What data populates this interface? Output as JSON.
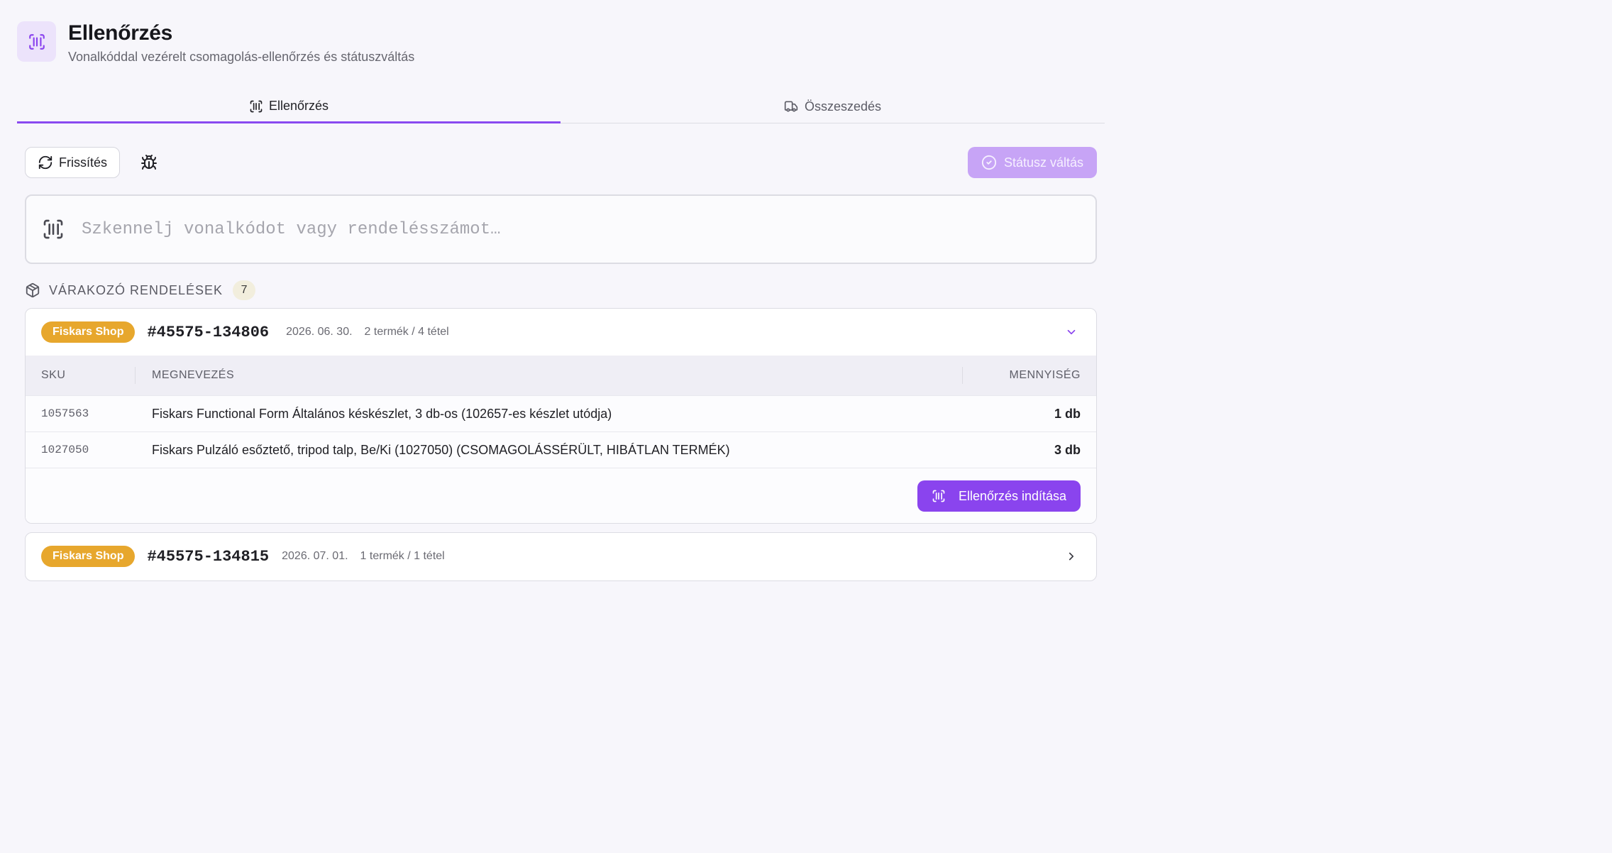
{
  "header": {
    "icon": "barcode-icon",
    "title": "Ellenőrzés",
    "subtitle": "Vonalkóddal vezérelt csomagolás-ellenőrzés és státuszváltás"
  },
  "tabs": [
    {
      "label": "Ellenőrzés",
      "icon": "barcode-icon",
      "active": true
    },
    {
      "label": "Összeszedés",
      "icon": "truck-icon",
      "active": false
    }
  ],
  "toolbar": {
    "refresh_label": "Frissítés",
    "debug_icon": "bug-icon",
    "status_label": "Státusz váltás"
  },
  "scan": {
    "placeholder": "Szkennelj vonalkódot vagy rendelésszámot…",
    "value": ""
  },
  "section": {
    "title": "VÁRAKOZÓ RENDELÉSEK",
    "count": "7"
  },
  "columns": {
    "sku": "SKU",
    "name": "MEGNEVEZÉS",
    "qty": "MENNYISÉG"
  },
  "orders": [
    {
      "shop": "Fiskars Shop",
      "id": "#45575-134806",
      "date": "2026. 06. 30.",
      "items": "2 termék / 4 tétel",
      "expanded": true,
      "lines": [
        {
          "sku": "1057563",
          "name": "Fiskars Functional Form Általános késkészlet, 3 db-os (102657-es készlet utódja)",
          "qty": "1 db"
        },
        {
          "sku": "1027050",
          "name": "Fiskars Pulzáló esőztető, tripod talp, Be/Ki (1027050) (CSOMAGOLÁSSÉRÜLT, HIBÁTLAN TERMÉK)",
          "qty": "3 db"
        }
      ],
      "action_label": "Ellenőrzés indítása"
    },
    {
      "shop": "Fiskars Shop",
      "id": "#45575-134815",
      "date": "2026. 07. 01.",
      "items": "1 termék / 1 tétel",
      "expanded": false
    }
  ],
  "colors": {
    "accent": "#8a44ee",
    "accent_light": "#c7a4f6",
    "shop_badge": "#e7a72d",
    "background": "#f7f6fb"
  }
}
